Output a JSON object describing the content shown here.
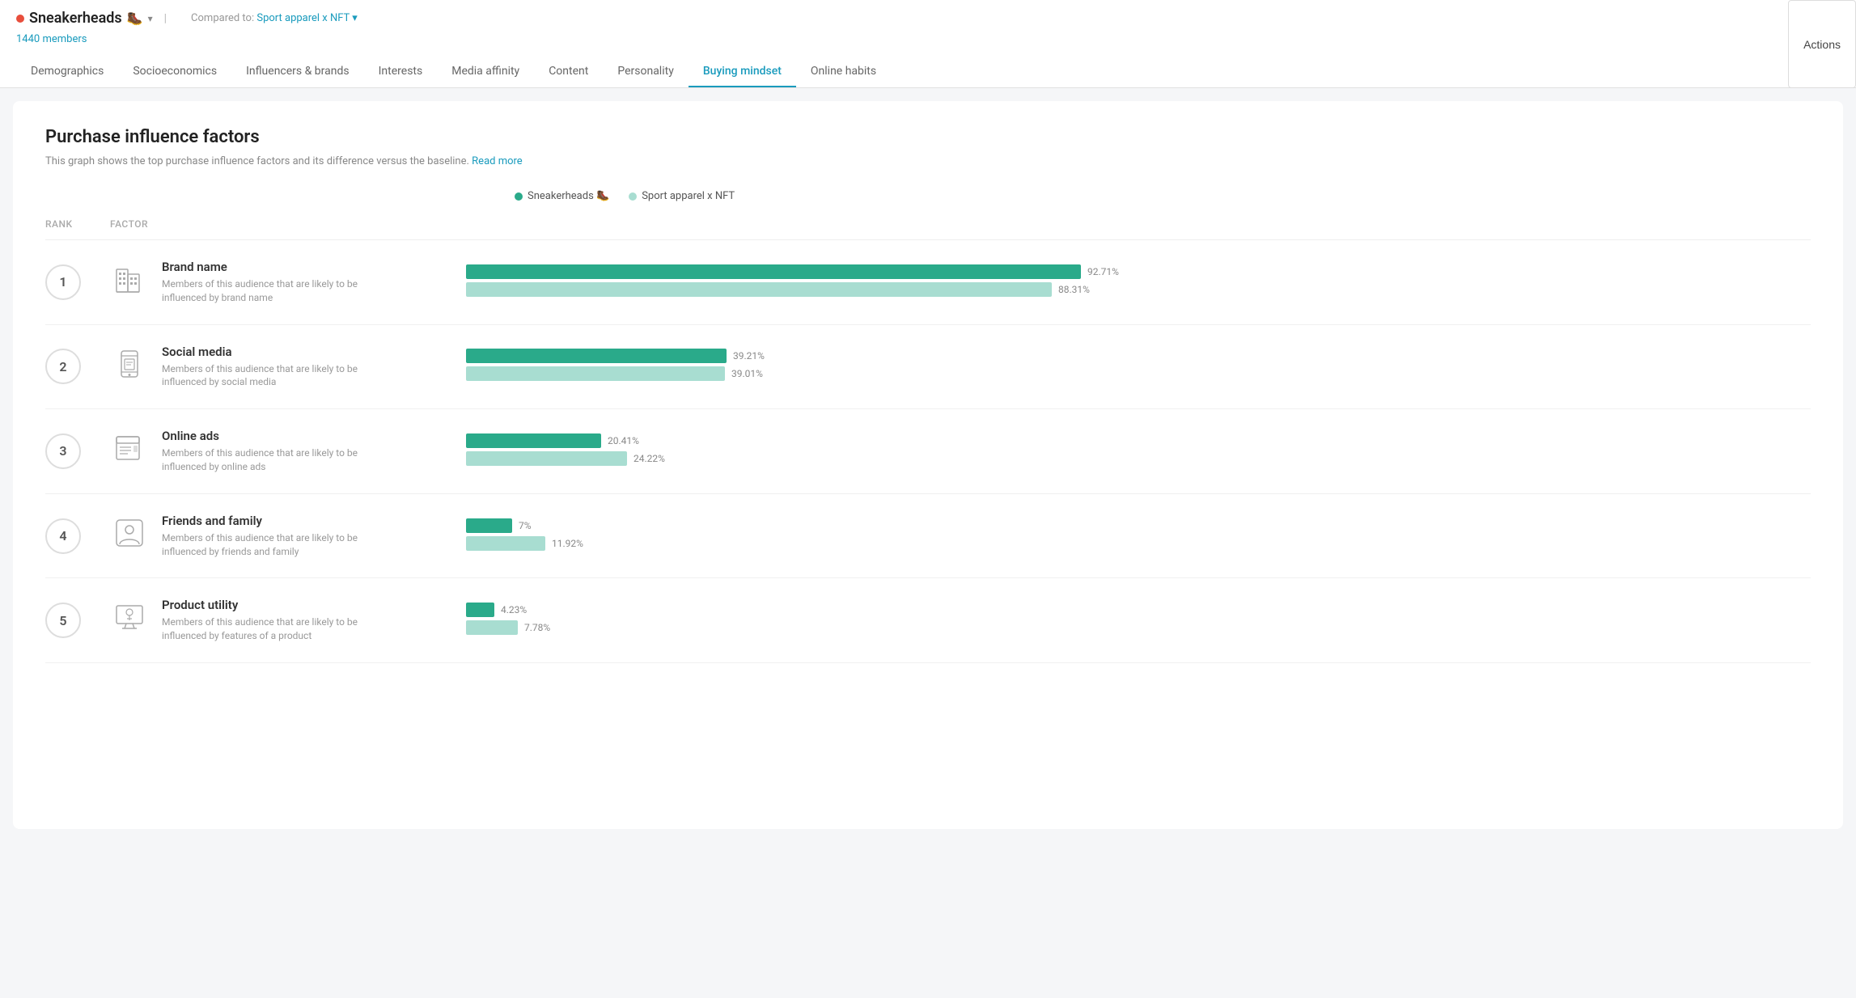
{
  "header": {
    "audience_name": "Sneakerheads",
    "audience_icon": "🥾",
    "members_count": "1440 members",
    "compared_to_label": "Compared to:",
    "compared_to_name": "Sport apparel x NFT",
    "actions_label": "Actions"
  },
  "nav": {
    "tabs": [
      {
        "id": "demographics",
        "label": "Demographics",
        "active": false
      },
      {
        "id": "socioeconomics",
        "label": "Socioeconomics",
        "active": false
      },
      {
        "id": "influencers",
        "label": "Influencers & brands",
        "active": false
      },
      {
        "id": "interests",
        "label": "Interests",
        "active": false
      },
      {
        "id": "media-affinity",
        "label": "Media affinity",
        "active": false
      },
      {
        "id": "content",
        "label": "Content",
        "active": false
      },
      {
        "id": "personality",
        "label": "Personality",
        "active": false
      },
      {
        "id": "buying-mindset",
        "label": "Buying mindset",
        "active": true
      },
      {
        "id": "online-habits",
        "label": "Online habits",
        "active": false
      }
    ]
  },
  "main": {
    "title": "Purchase influence factors",
    "description": "This graph shows the top purchase influence factors and its difference versus the baseline.",
    "read_more": "Read more",
    "rank_col_label": "Rank",
    "factor_col_label": "Factor",
    "legend": {
      "primary_label": "Sneakerheads 🥾",
      "secondary_label": "Sport apparel x NFT",
      "primary_color": "#2aaa8a",
      "secondary_color": "#a8ddd1"
    },
    "factors": [
      {
        "rank": "1",
        "name": "Brand name",
        "description": "Members of this audience that are likely to be influenced by brand name",
        "primary_pct": 92.71,
        "secondary_pct": 88.31,
        "primary_label": "92.71%",
        "secondary_label": "88.31%",
        "icon": "building"
      },
      {
        "rank": "2",
        "name": "Social media",
        "description": "Members of this audience that are likely to be influenced by social media",
        "primary_pct": 39.21,
        "secondary_pct": 39.01,
        "primary_label": "39.21%",
        "secondary_label": "39.01%",
        "icon": "phone"
      },
      {
        "rank": "3",
        "name": "Online ads",
        "description": "Members of this audience that are likely to be influenced by online ads",
        "primary_pct": 20.41,
        "secondary_pct": 24.22,
        "primary_label": "20.41%",
        "secondary_label": "24.22%",
        "icon": "newspaper"
      },
      {
        "rank": "4",
        "name": "Friends and family",
        "description": "Members of this audience that are likely to be influenced by friends and family",
        "primary_pct": 7.0,
        "secondary_pct": 11.92,
        "primary_label": "7%",
        "secondary_label": "11.92%",
        "icon": "face"
      },
      {
        "rank": "5",
        "name": "Product utility",
        "description": "Members of this audience that are likely to be influenced by features of a product",
        "primary_pct": 4.23,
        "secondary_pct": 7.78,
        "primary_label": "4.23%",
        "secondary_label": "7.78%",
        "icon": "monitor"
      }
    ]
  }
}
